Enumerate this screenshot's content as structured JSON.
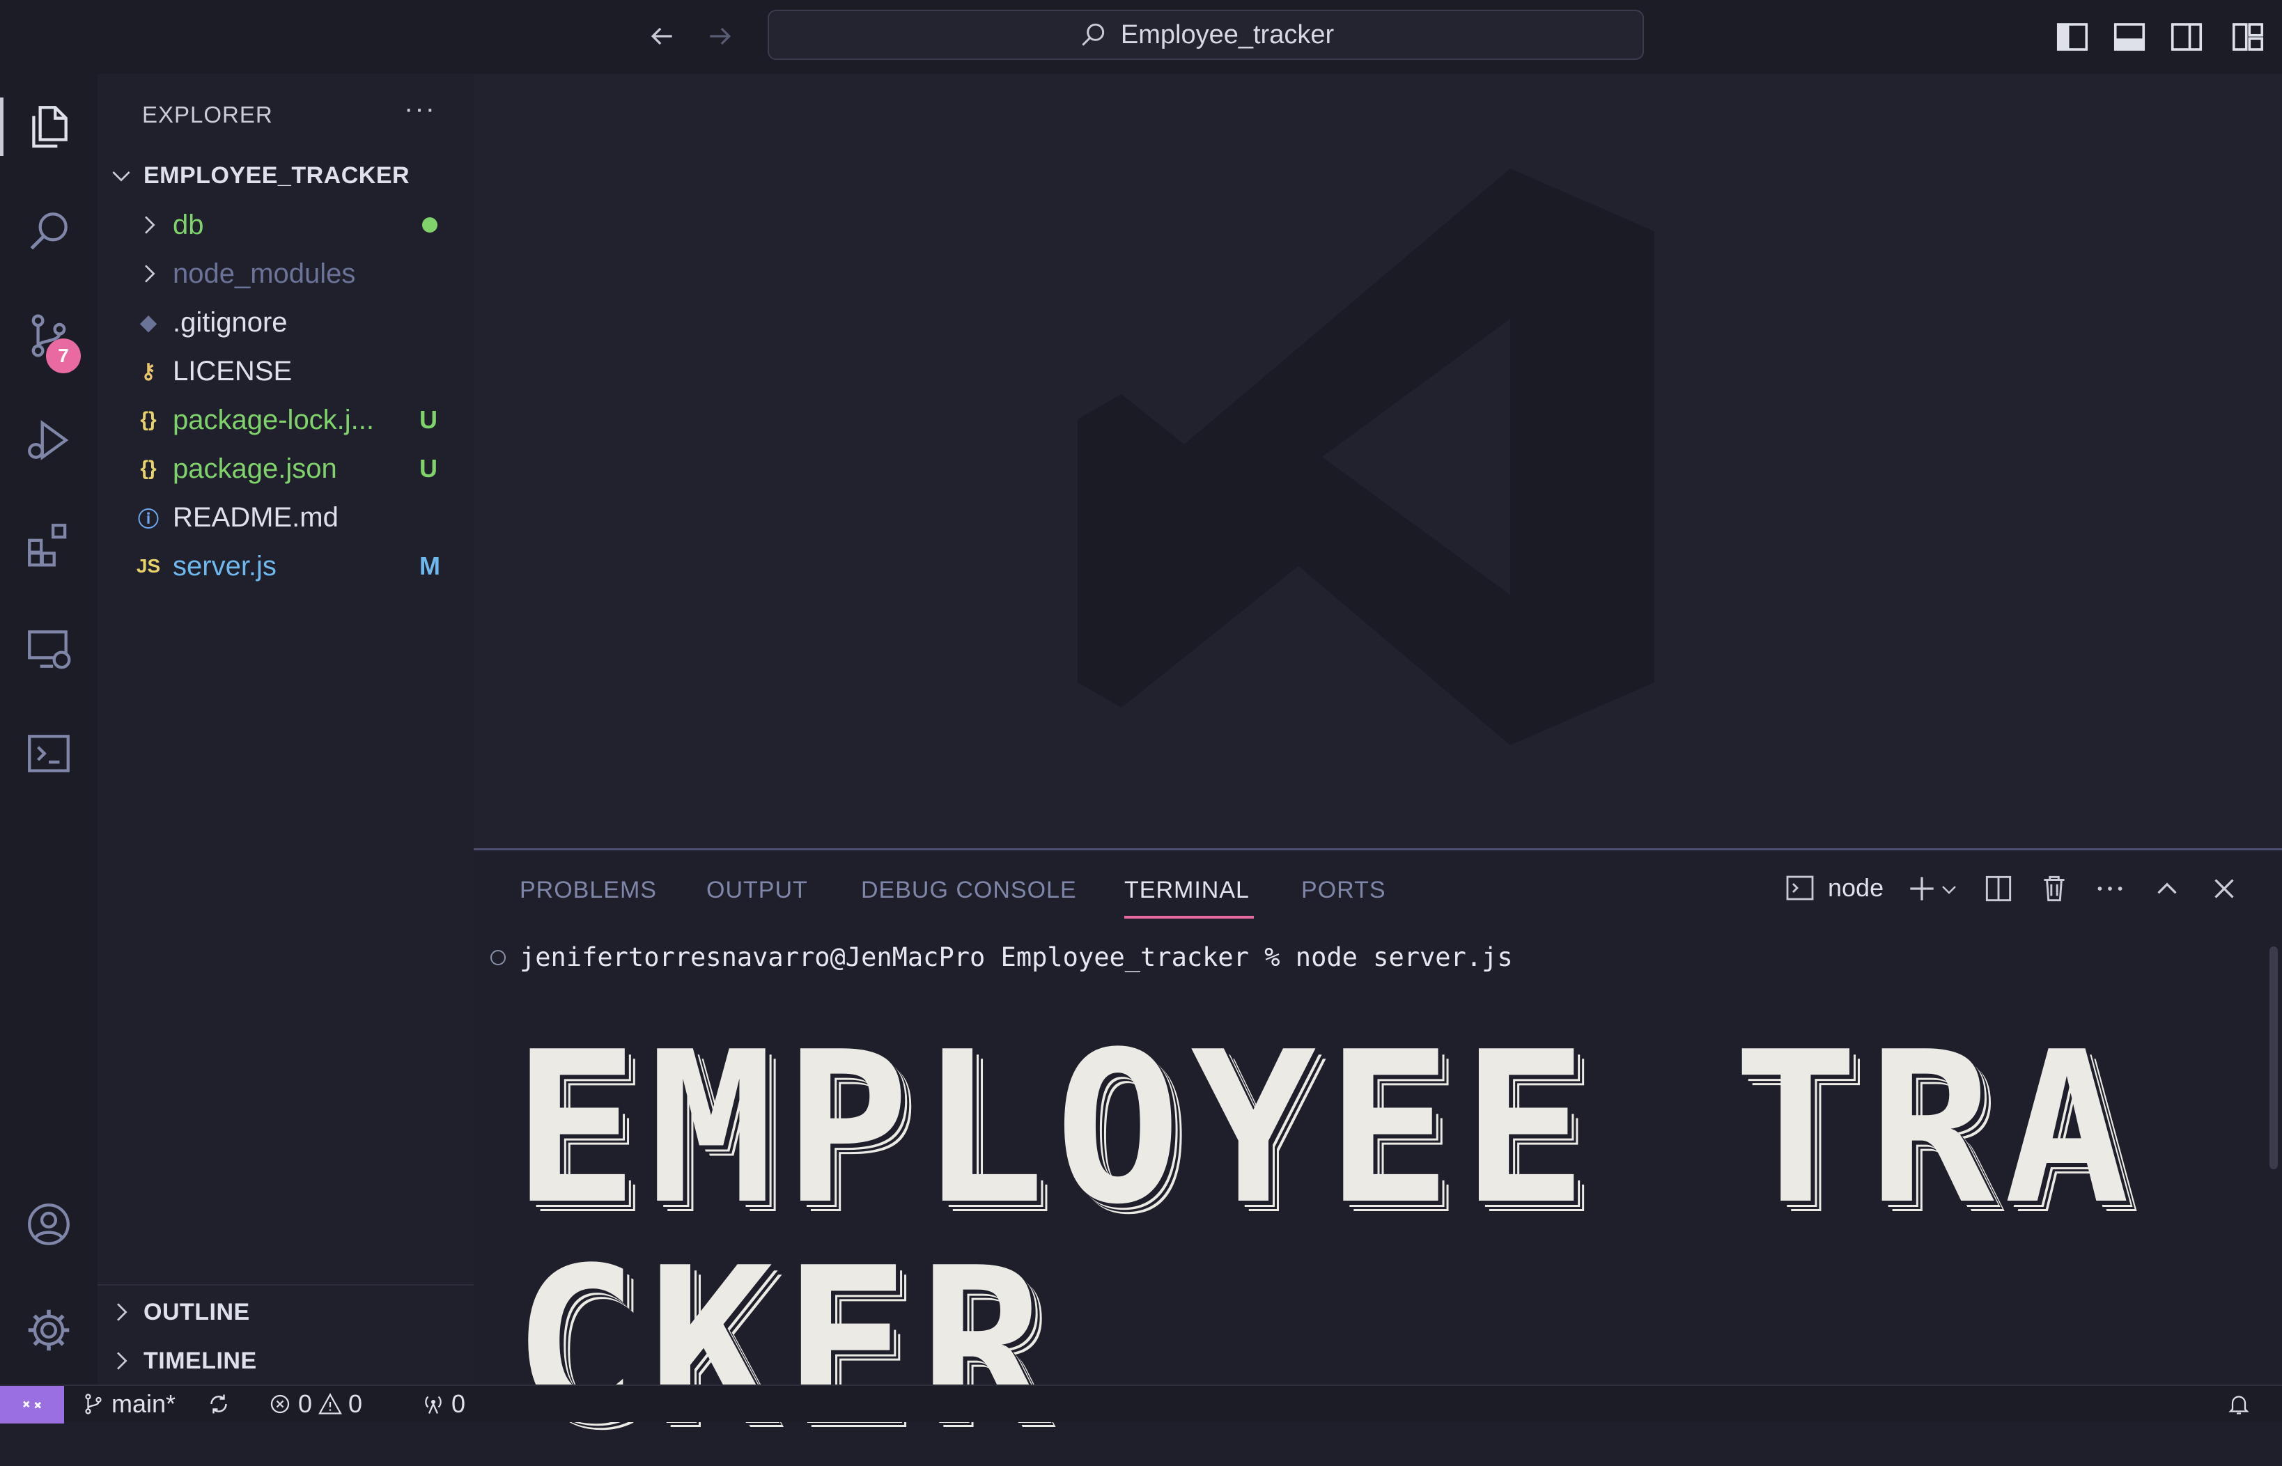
{
  "titlebar": {
    "search_text": "Employee_tracker"
  },
  "activitybar": {
    "scm_badge": "7"
  },
  "sidebar": {
    "header": "EXPLORER",
    "more": "···",
    "project": "EMPLOYEE_TRACKER",
    "files": [
      {
        "name": "db",
        "color": "#7fd36a",
        "status": "",
        "has_dot": true
      },
      {
        "name": "node_modules",
        "color": "#6b7398",
        "status": ""
      },
      {
        "name": ".gitignore",
        "color": "#dfe1ea",
        "status": ""
      },
      {
        "name": "LICENSE",
        "color": "#dfe1ea",
        "status": ""
      },
      {
        "name": "package-lock.j...",
        "color": "#7fd36a",
        "status": "U"
      },
      {
        "name": "package.json",
        "color": "#7fd36a",
        "status": "U"
      },
      {
        "name": "README.md",
        "color": "#dfe1ea",
        "status": ""
      },
      {
        "name": "server.js",
        "color": "#6fb8ee",
        "status": "M"
      }
    ],
    "outline": "OUTLINE",
    "timeline": "TIMELINE"
  },
  "panel": {
    "tabs": [
      "PROBLEMS",
      "OUTPUT",
      "DEBUG CONSOLE",
      "TERMINAL",
      "PORTS"
    ],
    "terminal_name": "node",
    "prompt": "jenifertorresnavarro@JenMacPro Employee_tracker % node server.js",
    "banner_line1": "EMPLOYEE TRA",
    "banner_line2": "CKER"
  },
  "statusbar": {
    "branch": "main*",
    "errors": "0",
    "warnings": "0",
    "ports": "0"
  },
  "colors": {
    "accent": "#e86aa0",
    "untracked": "#7fd36a",
    "modified": "#6fb8ee",
    "remote": "#9a6fe0"
  }
}
